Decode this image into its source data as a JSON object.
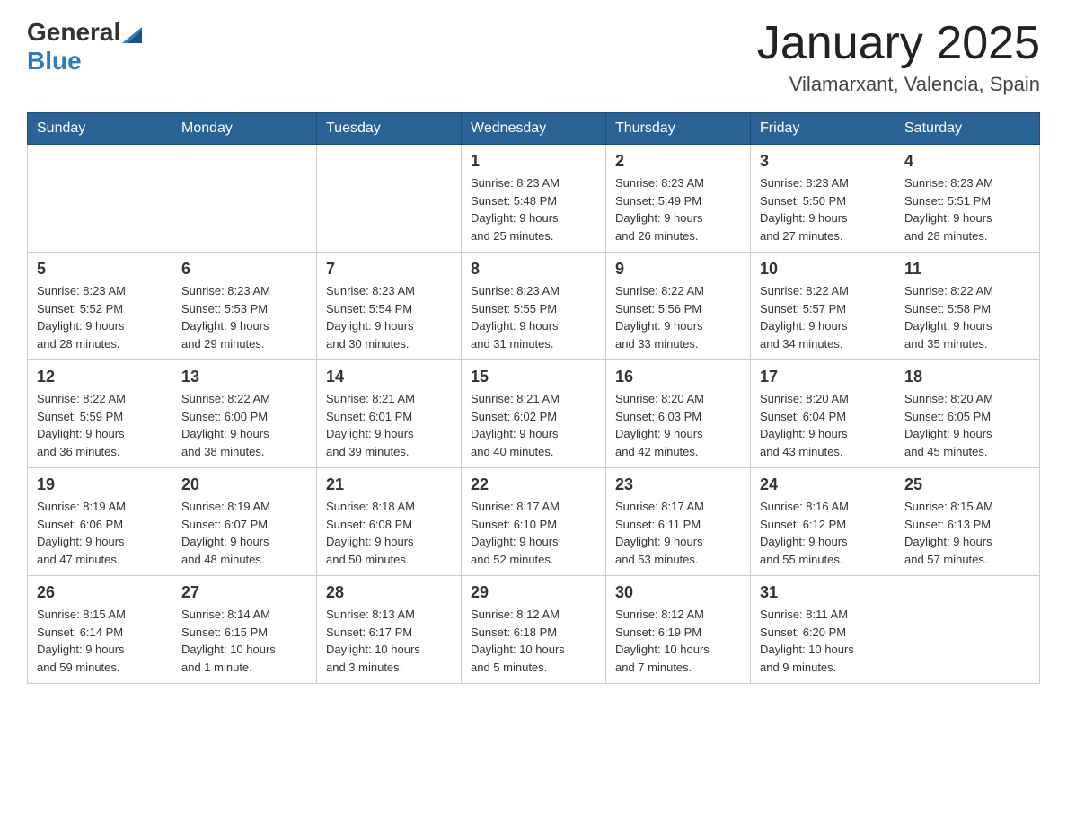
{
  "header": {
    "logo_general": "General",
    "logo_blue": "Blue",
    "month_title": "January 2025",
    "location": "Vilamarxant, Valencia, Spain"
  },
  "days_of_week": [
    "Sunday",
    "Monday",
    "Tuesday",
    "Wednesday",
    "Thursday",
    "Friday",
    "Saturday"
  ],
  "weeks": [
    [
      {
        "day": "",
        "info": ""
      },
      {
        "day": "",
        "info": ""
      },
      {
        "day": "",
        "info": ""
      },
      {
        "day": "1",
        "info": "Sunrise: 8:23 AM\nSunset: 5:48 PM\nDaylight: 9 hours\nand 25 minutes."
      },
      {
        "day": "2",
        "info": "Sunrise: 8:23 AM\nSunset: 5:49 PM\nDaylight: 9 hours\nand 26 minutes."
      },
      {
        "day": "3",
        "info": "Sunrise: 8:23 AM\nSunset: 5:50 PM\nDaylight: 9 hours\nand 27 minutes."
      },
      {
        "day": "4",
        "info": "Sunrise: 8:23 AM\nSunset: 5:51 PM\nDaylight: 9 hours\nand 28 minutes."
      }
    ],
    [
      {
        "day": "5",
        "info": "Sunrise: 8:23 AM\nSunset: 5:52 PM\nDaylight: 9 hours\nand 28 minutes."
      },
      {
        "day": "6",
        "info": "Sunrise: 8:23 AM\nSunset: 5:53 PM\nDaylight: 9 hours\nand 29 minutes."
      },
      {
        "day": "7",
        "info": "Sunrise: 8:23 AM\nSunset: 5:54 PM\nDaylight: 9 hours\nand 30 minutes."
      },
      {
        "day": "8",
        "info": "Sunrise: 8:23 AM\nSunset: 5:55 PM\nDaylight: 9 hours\nand 31 minutes."
      },
      {
        "day": "9",
        "info": "Sunrise: 8:22 AM\nSunset: 5:56 PM\nDaylight: 9 hours\nand 33 minutes."
      },
      {
        "day": "10",
        "info": "Sunrise: 8:22 AM\nSunset: 5:57 PM\nDaylight: 9 hours\nand 34 minutes."
      },
      {
        "day": "11",
        "info": "Sunrise: 8:22 AM\nSunset: 5:58 PM\nDaylight: 9 hours\nand 35 minutes."
      }
    ],
    [
      {
        "day": "12",
        "info": "Sunrise: 8:22 AM\nSunset: 5:59 PM\nDaylight: 9 hours\nand 36 minutes."
      },
      {
        "day": "13",
        "info": "Sunrise: 8:22 AM\nSunset: 6:00 PM\nDaylight: 9 hours\nand 38 minutes."
      },
      {
        "day": "14",
        "info": "Sunrise: 8:21 AM\nSunset: 6:01 PM\nDaylight: 9 hours\nand 39 minutes."
      },
      {
        "day": "15",
        "info": "Sunrise: 8:21 AM\nSunset: 6:02 PM\nDaylight: 9 hours\nand 40 minutes."
      },
      {
        "day": "16",
        "info": "Sunrise: 8:20 AM\nSunset: 6:03 PM\nDaylight: 9 hours\nand 42 minutes."
      },
      {
        "day": "17",
        "info": "Sunrise: 8:20 AM\nSunset: 6:04 PM\nDaylight: 9 hours\nand 43 minutes."
      },
      {
        "day": "18",
        "info": "Sunrise: 8:20 AM\nSunset: 6:05 PM\nDaylight: 9 hours\nand 45 minutes."
      }
    ],
    [
      {
        "day": "19",
        "info": "Sunrise: 8:19 AM\nSunset: 6:06 PM\nDaylight: 9 hours\nand 47 minutes."
      },
      {
        "day": "20",
        "info": "Sunrise: 8:19 AM\nSunset: 6:07 PM\nDaylight: 9 hours\nand 48 minutes."
      },
      {
        "day": "21",
        "info": "Sunrise: 8:18 AM\nSunset: 6:08 PM\nDaylight: 9 hours\nand 50 minutes."
      },
      {
        "day": "22",
        "info": "Sunrise: 8:17 AM\nSunset: 6:10 PM\nDaylight: 9 hours\nand 52 minutes."
      },
      {
        "day": "23",
        "info": "Sunrise: 8:17 AM\nSunset: 6:11 PM\nDaylight: 9 hours\nand 53 minutes."
      },
      {
        "day": "24",
        "info": "Sunrise: 8:16 AM\nSunset: 6:12 PM\nDaylight: 9 hours\nand 55 minutes."
      },
      {
        "day": "25",
        "info": "Sunrise: 8:15 AM\nSunset: 6:13 PM\nDaylight: 9 hours\nand 57 minutes."
      }
    ],
    [
      {
        "day": "26",
        "info": "Sunrise: 8:15 AM\nSunset: 6:14 PM\nDaylight: 9 hours\nand 59 minutes."
      },
      {
        "day": "27",
        "info": "Sunrise: 8:14 AM\nSunset: 6:15 PM\nDaylight: 10 hours\nand 1 minute."
      },
      {
        "day": "28",
        "info": "Sunrise: 8:13 AM\nSunset: 6:17 PM\nDaylight: 10 hours\nand 3 minutes."
      },
      {
        "day": "29",
        "info": "Sunrise: 8:12 AM\nSunset: 6:18 PM\nDaylight: 10 hours\nand 5 minutes."
      },
      {
        "day": "30",
        "info": "Sunrise: 8:12 AM\nSunset: 6:19 PM\nDaylight: 10 hours\nand 7 minutes."
      },
      {
        "day": "31",
        "info": "Sunrise: 8:11 AM\nSunset: 6:20 PM\nDaylight: 10 hours\nand 9 minutes."
      },
      {
        "day": "",
        "info": ""
      }
    ]
  ]
}
